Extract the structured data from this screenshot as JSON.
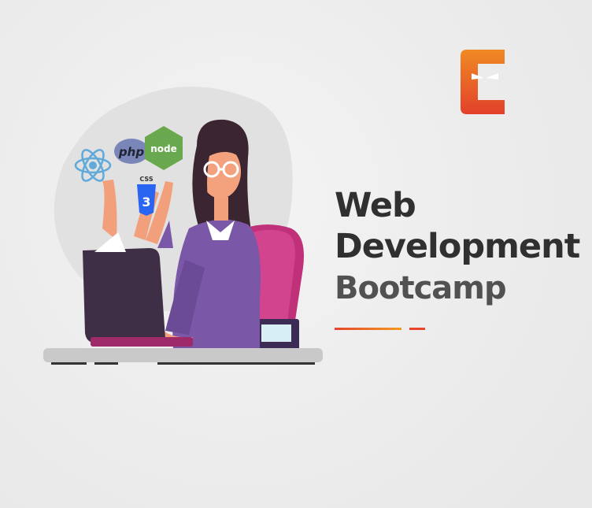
{
  "title": {
    "line1": "Web",
    "line2": "Development",
    "line3": "Bootcamp"
  },
  "icons": {
    "logo": "coding-ninjas-logo",
    "react": "react-icon",
    "php": "php-icon",
    "node": "nodejs-icon",
    "css": "css3-icon"
  },
  "badges": {
    "php": "php",
    "node": "node",
    "css": "CSS"
  },
  "colors": {
    "background": "#efefef",
    "title": "#303030",
    "subtitle": "#515151",
    "accent_orange": "#e8452c",
    "accent_yellow": "#f39a1e",
    "react_blue": "#61a9d9",
    "php_purple": "#7a86b8",
    "node_green": "#6aa84f",
    "css_blue": "#2965f1",
    "dress_purple": "#7b57a8",
    "chair_pink": "#c0317a"
  }
}
